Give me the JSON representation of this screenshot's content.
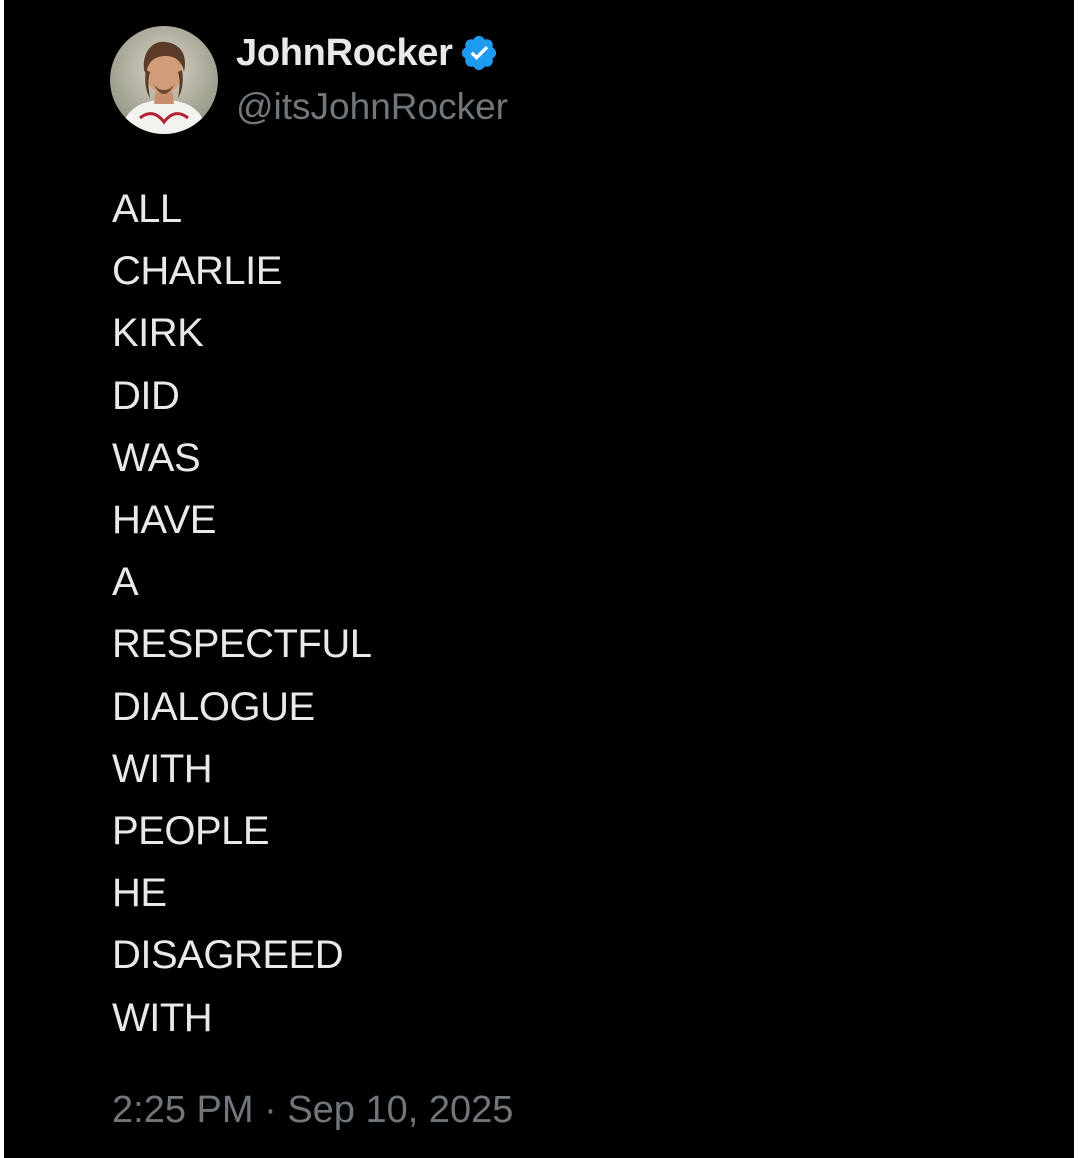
{
  "tweet": {
    "author": {
      "display_name": "JohnRocker",
      "handle": "@itsJohnRocker",
      "verified": true,
      "verified_color": "#1d9bf0",
      "avatar_icon": "profile-photo-icon"
    },
    "text_lines": [
      "ALL",
      "CHARLIE",
      "KIRK",
      "DID",
      "WAS",
      "HAVE",
      "A",
      "RESPECTFUL",
      "DIALOGUE",
      "WITH",
      "PEOPLE",
      "HE",
      "DISAGREED",
      "WITH"
    ],
    "time": "2:25 PM",
    "separator": " · ",
    "date": "Sep 10, 2025"
  },
  "theme": {
    "background": "#000000",
    "primary_text": "#e7e9ea",
    "secondary_text": "#71767b"
  }
}
